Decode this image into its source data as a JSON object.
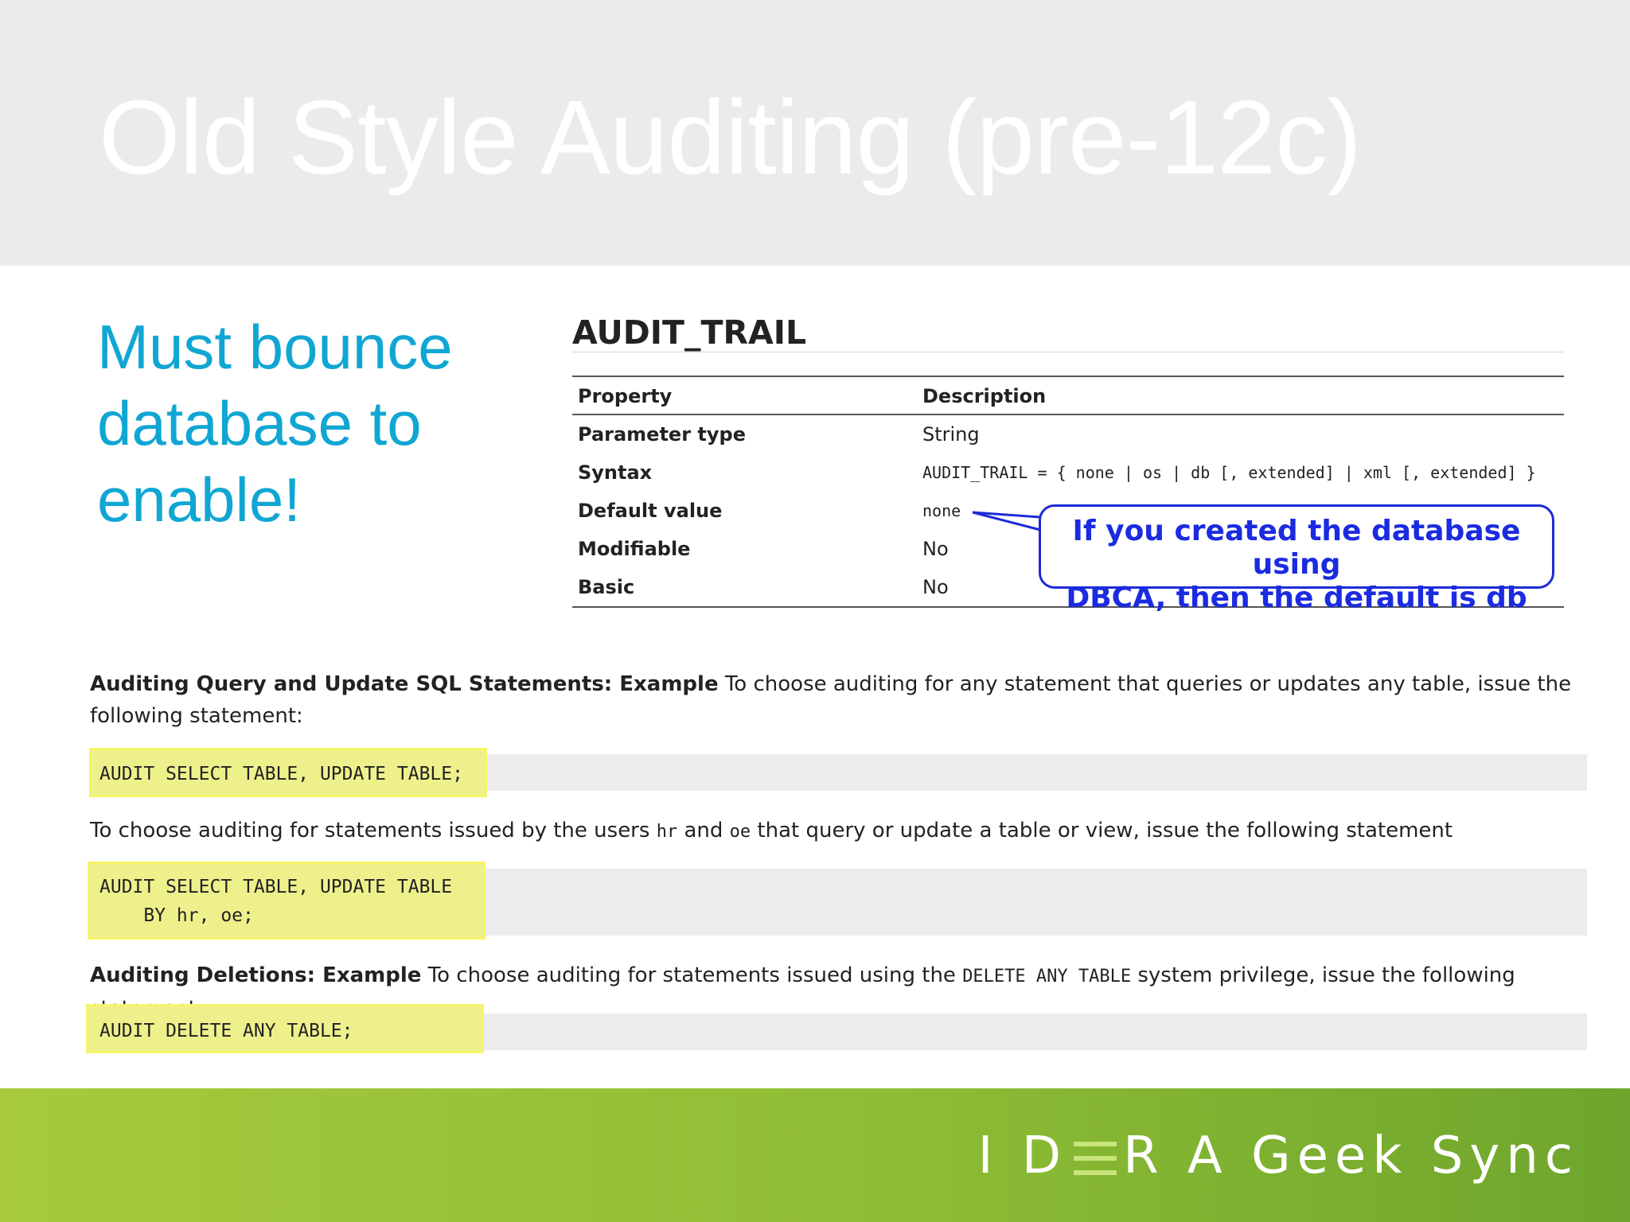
{
  "slide": {
    "title": "Old Style Auditing (pre-12c)",
    "note": "Must bounce database to enable!"
  },
  "doc": {
    "param_title": "AUDIT_TRAIL",
    "table": {
      "headers": [
        "Property",
        "Description"
      ],
      "rows": [
        {
          "property": "Parameter type",
          "description": "String"
        },
        {
          "property": "Syntax",
          "description": "AUDIT_TRAIL = { none | os | db [, extended] | xml [, extended] }"
        },
        {
          "property": "Default value",
          "description": "none"
        },
        {
          "property": "Modifiable",
          "description": "No"
        },
        {
          "property": "Basic",
          "description": "No"
        }
      ]
    },
    "callout": {
      "line1": "If you created the database using",
      "line2": "DBCA, then the default is db"
    },
    "examples": {
      "ex1_label": "Auditing Query and Update SQL Statements: Example",
      "ex1_text": " To choose auditing for any statement that queries or updates any table, issue the following statement:",
      "code1": "AUDIT SELECT TABLE, UPDATE TABLE;",
      "ex2_text_1": "To choose auditing for statements issued by the users ",
      "ex2_user1": "hr",
      "ex2_text_2": " and ",
      "ex2_user2": "oe",
      "ex2_text_3": " that query or update a table or view, issue the following statement",
      "code2_line1": "AUDIT SELECT TABLE, UPDATE TABLE",
      "code2_line2": "    BY hr, oe;",
      "ex3_label": "Auditing Deletions: Example",
      "ex3_text_1": " To choose auditing for statements issued using the ",
      "ex3_priv": "DELETE ANY TABLE",
      "ex3_text_2": " system privilege, issue the following statement:",
      "code3": "AUDIT DELETE ANY TABLE;"
    }
  },
  "footer": {
    "brand_left": "I D",
    "brand_right": "R A Geek Sync"
  },
  "colors": {
    "title_band": "#edebea",
    "accent_blue": "#10a6d4",
    "callout_blue": "#1e2bd6",
    "highlight_yellow": "#eef08c",
    "footer_green": "#8ebd35"
  }
}
